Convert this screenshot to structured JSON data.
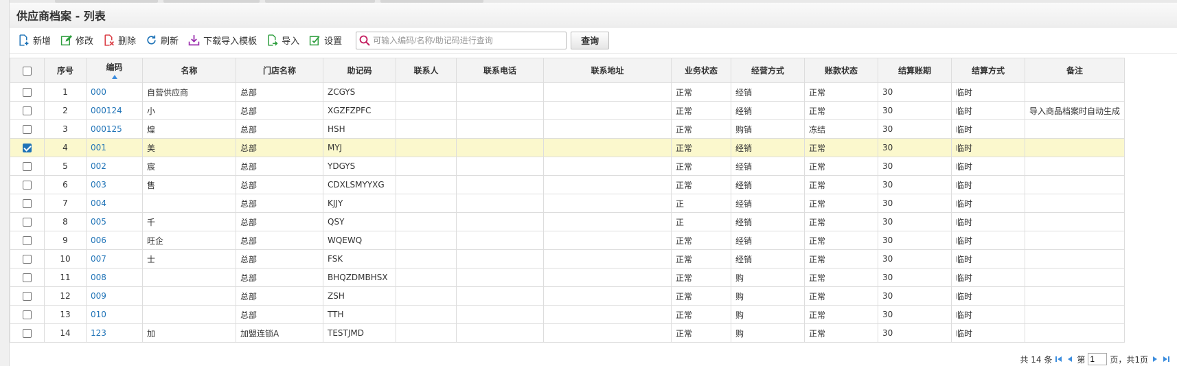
{
  "title": "供应商档案 - 列表",
  "toolbar": {
    "buttons": [
      {
        "label": "新增",
        "icon": "add-doc-icon",
        "color": "#1f73b7"
      },
      {
        "label": "修改",
        "icon": "edit-icon",
        "color": "#2e9e3e"
      },
      {
        "label": "删除",
        "icon": "delete-icon",
        "color": "#d9363e"
      },
      {
        "label": "刷新",
        "icon": "refresh-icon",
        "color": "#1f73b7"
      },
      {
        "label": "下载导入模板",
        "icon": "download-icon",
        "color": "#9b2fae"
      },
      {
        "label": "导入",
        "icon": "import-icon",
        "color": "#2e9e3e"
      },
      {
        "label": "设置",
        "icon": "settings-icon",
        "color": "#2e9e3e"
      }
    ],
    "search_placeholder": "可输入编码/名称/助记码进行查询",
    "query_label": "查询"
  },
  "table": {
    "columns": [
      "",
      "序号",
      "编码",
      "名称",
      "门店名称",
      "助记码",
      "联系人",
      "联系电话",
      "联系地址",
      "业务状态",
      "经营方式",
      "账款状态",
      "结算账期",
      "结算方式",
      "备注"
    ],
    "rows": [
      {
        "checked": false,
        "seq": "1",
        "code": "000",
        "name": "自营供应商",
        "store": "总部",
        "mnemonic": "ZCGYS",
        "contact": "",
        "phone": "",
        "address": "",
        "biz_status": "正常",
        "mode": "经销",
        "acct_status": "正常",
        "period": "30",
        "settle": "临时",
        "remark": ""
      },
      {
        "checked": false,
        "seq": "2",
        "code": "000124",
        "name": "小",
        "store": "总部",
        "mnemonic": "XGZFZPFC",
        "contact": "",
        "phone": "",
        "address": "",
        "biz_status": "正常",
        "mode": "经销",
        "acct_status": "正常",
        "period": "30",
        "settle": "临时",
        "remark": "导入商品档案时自动生成"
      },
      {
        "checked": false,
        "seq": "3",
        "code": "000125",
        "name": "煌",
        "store": "总部",
        "mnemonic": "HSH",
        "contact": "",
        "phone": "",
        "address": "",
        "biz_status": "正常",
        "mode": "购销",
        "acct_status": "冻结",
        "period": "30",
        "settle": "临时",
        "remark": ""
      },
      {
        "checked": true,
        "seq": "4",
        "code": "001",
        "name": "美",
        "store": "总部",
        "mnemonic": "MYJ",
        "contact": "",
        "phone": "",
        "address": "",
        "biz_status": "正常",
        "mode": "经销",
        "acct_status": "正常",
        "period": "30",
        "settle": "临时",
        "remark": ""
      },
      {
        "checked": false,
        "seq": "5",
        "code": "002",
        "name": "宸",
        "store": "总部",
        "mnemonic": "YDGYS",
        "contact": "",
        "phone": "",
        "address": "",
        "biz_status": "正常",
        "mode": "经销",
        "acct_status": "正常",
        "period": "30",
        "settle": "临时",
        "remark": ""
      },
      {
        "checked": false,
        "seq": "6",
        "code": "003",
        "name": "售",
        "store": "总部",
        "mnemonic": "CDXLSMYYXG",
        "contact": "",
        "phone": "",
        "address": "",
        "biz_status": "正常",
        "mode": "经销",
        "acct_status": "正常",
        "period": "30",
        "settle": "临时",
        "remark": ""
      },
      {
        "checked": false,
        "seq": "7",
        "code": "004",
        "name": "",
        "store": "总部",
        "mnemonic": "KJJY",
        "contact": "",
        "phone": "",
        "address": "",
        "biz_status": "正",
        "mode": "经销",
        "acct_status": "正常",
        "period": "30",
        "settle": "临时",
        "remark": ""
      },
      {
        "checked": false,
        "seq": "8",
        "code": "005",
        "name": "千",
        "store": "总部",
        "mnemonic": "QSY",
        "contact": "",
        "phone": "",
        "address": "",
        "biz_status": "正",
        "mode": "经销",
        "acct_status": "正常",
        "period": "30",
        "settle": "临时",
        "remark": ""
      },
      {
        "checked": false,
        "seq": "9",
        "code": "006",
        "name": "旺企",
        "store": "总部",
        "mnemonic": "WQEWQ",
        "contact": "",
        "phone": "",
        "address": "",
        "biz_status": "正常",
        "mode": "经销",
        "acct_status": "正常",
        "period": "30",
        "settle": "临时",
        "remark": ""
      },
      {
        "checked": false,
        "seq": "10",
        "code": "007",
        "name": "士",
        "store": "总部",
        "mnemonic": "FSK",
        "contact": "",
        "phone": "",
        "address": "",
        "biz_status": "正常",
        "mode": "经销",
        "acct_status": "正常",
        "period": "30",
        "settle": "临时",
        "remark": ""
      },
      {
        "checked": false,
        "seq": "11",
        "code": "008",
        "name": "",
        "store": "总部",
        "mnemonic": "BHQZDMBHSX",
        "contact": "",
        "phone": "",
        "address": "",
        "biz_status": "正常",
        "mode": "购",
        "acct_status": "正常",
        "period": "30",
        "settle": "临时",
        "remark": ""
      },
      {
        "checked": false,
        "seq": "12",
        "code": "009",
        "name": "",
        "store": "总部",
        "mnemonic": "ZSH",
        "contact": "",
        "phone": "",
        "address": "",
        "biz_status": "正常",
        "mode": "购",
        "acct_status": "正常",
        "period": "30",
        "settle": "临时",
        "remark": ""
      },
      {
        "checked": false,
        "seq": "13",
        "code": "010",
        "name": "",
        "store": "总部",
        "mnemonic": "TTH",
        "contact": "",
        "phone": "",
        "address": "",
        "biz_status": "正常",
        "mode": "购",
        "acct_status": "正常",
        "period": "30",
        "settle": "临时",
        "remark": ""
      },
      {
        "checked": false,
        "seq": "14",
        "code": "123",
        "name": "加",
        "store": "加盟连锁A",
        "mnemonic": "TESTJMD",
        "contact": "",
        "phone": "",
        "address": "",
        "biz_status": "正常",
        "mode": "购",
        "acct_status": "正常",
        "period": "30",
        "settle": "临时",
        "remark": ""
      }
    ]
  },
  "pager": {
    "total_text": "共 14 条",
    "page_prefix": "第",
    "page_value": "1",
    "page_suffix": "页，共1页"
  },
  "colors": {
    "link": "#1f73b7",
    "selected_row": "#fbf8cd",
    "header_bg": "#f3f3f3",
    "search_icon": "#c2185b"
  }
}
